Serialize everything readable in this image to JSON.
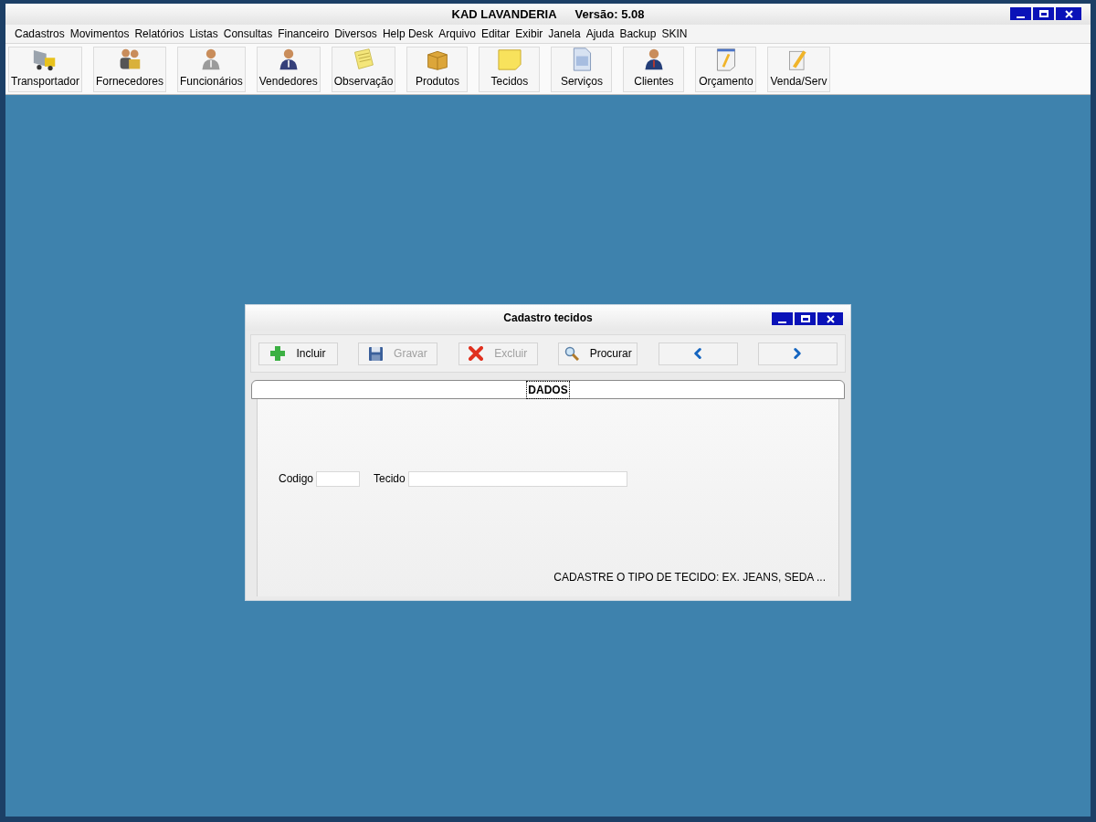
{
  "window": {
    "title": "KAD LAVANDERIA",
    "version": "Versão: 5.08"
  },
  "menu": [
    "Cadastros",
    "Movimentos",
    "Relatórios",
    "Listas",
    "Consultas",
    "Financeiro",
    "Diversos",
    "Help Desk",
    "Arquivo",
    "Editar",
    "Exibir",
    "Janela",
    "Ajuda",
    "Backup",
    "SKIN"
  ],
  "toolbar": [
    {
      "label": "Transportador",
      "kind": "truck"
    },
    {
      "label": "Fornecedores",
      "kind": "people"
    },
    {
      "label": "Funcionários",
      "kind": "person-gray"
    },
    {
      "label": "Vendedores",
      "kind": "person-blue"
    },
    {
      "label": "Observação",
      "kind": "note"
    },
    {
      "label": "Produtos",
      "kind": "box"
    },
    {
      "label": "Tecidos",
      "kind": "sticky"
    },
    {
      "label": "Serviços",
      "kind": "document"
    },
    {
      "label": "Clientes",
      "kind": "person-red"
    },
    {
      "label": "Orçamento",
      "kind": "pencil-doc"
    },
    {
      "label": "Venda/Serv",
      "kind": "pencil"
    }
  ],
  "dialog": {
    "title": "Cadastro tecidos",
    "buttons": [
      {
        "label": "Incluir",
        "kind": "add",
        "disabled": false
      },
      {
        "label": "Gravar",
        "kind": "save",
        "disabled": true
      },
      {
        "label": "Excluir",
        "kind": "delete",
        "disabled": true
      },
      {
        "label": "Procurar",
        "kind": "search",
        "disabled": false
      },
      {
        "kind": "previous",
        "disabled": false
      },
      {
        "kind": "next",
        "disabled": false
      }
    ],
    "tab": {
      "label": "DADOS",
      "selected": true
    },
    "fields": [
      {
        "label": "Codigo"
      },
      {
        "label": "Tecido"
      }
    ],
    "hint": "CADASTRE O TIPO DE TECIDO: EX. JEANS, SEDA ..."
  }
}
